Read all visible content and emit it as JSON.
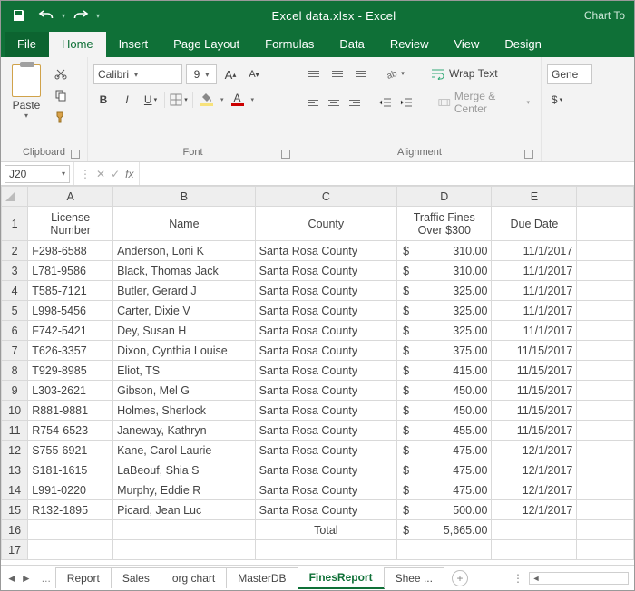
{
  "title": "Excel data.xlsx - Excel",
  "title_right": "Chart To",
  "tabs": {
    "file": "File",
    "home": "Home",
    "insert": "Insert",
    "pagelayout": "Page Layout",
    "formulas": "Formulas",
    "data": "Data",
    "review": "Review",
    "view": "View",
    "design": "Design"
  },
  "clipboard": {
    "paste": "Paste",
    "label": "Clipboard"
  },
  "font": {
    "name": "Calibri",
    "size": "9",
    "label": "Font"
  },
  "alignment": {
    "wrap": "Wrap Text",
    "merge": "Merge & Center",
    "label": "Alignment"
  },
  "number": {
    "format": "Gene"
  },
  "namebox": "J20",
  "fx": "",
  "columns": [
    "A",
    "B",
    "C",
    "D",
    "E"
  ],
  "headers": {
    "A": "License Number",
    "B": "Name",
    "C": "County",
    "D": "Traffic Fines Over $300",
    "E": "Due Date"
  },
  "rows": [
    {
      "n": "2",
      "A": "F298-6588",
      "B": "Anderson, Loni K",
      "C": "Santa Rosa County",
      "D": "310.00",
      "E": "11/1/2017"
    },
    {
      "n": "3",
      "A": "L781-9586",
      "B": "Black, Thomas Jack",
      "C": "Santa Rosa County",
      "D": "310.00",
      "E": "11/1/2017"
    },
    {
      "n": "4",
      "A": "T585-7121",
      "B": "Butler, Gerard J",
      "C": "Santa Rosa County",
      "D": "325.00",
      "E": "11/1/2017"
    },
    {
      "n": "5",
      "A": "L998-5456",
      "B": "Carter, Dixie V",
      "C": "Santa Rosa County",
      "D": "325.00",
      "E": "11/1/2017"
    },
    {
      "n": "6",
      "A": "F742-5421",
      "B": "Dey, Susan H",
      "C": "Santa Rosa County",
      "D": "325.00",
      "E": "11/1/2017"
    },
    {
      "n": "7",
      "A": "T626-3357",
      "B": "Dixon, Cynthia Louise",
      "C": "Santa Rosa County",
      "D": "375.00",
      "E": "11/15/2017"
    },
    {
      "n": "8",
      "A": "T929-8985",
      "B": "Eliot, TS",
      "C": "Santa Rosa County",
      "D": "415.00",
      "E": "11/15/2017"
    },
    {
      "n": "9",
      "A": "L303-2621",
      "B": "Gibson, Mel G",
      "C": "Santa Rosa County",
      "D": "450.00",
      "E": "11/15/2017"
    },
    {
      "n": "10",
      "A": "R881-9881",
      "B": "Holmes, Sherlock",
      "C": "Santa Rosa County",
      "D": "450.00",
      "E": "11/15/2017"
    },
    {
      "n": "11",
      "A": "R754-6523",
      "B": "Janeway, Kathryn",
      "C": "Santa Rosa County",
      "D": "455.00",
      "E": "11/15/2017"
    },
    {
      "n": "12",
      "A": "S755-6921",
      "B": "Kane, Carol Laurie",
      "C": "Santa Rosa County",
      "D": "475.00",
      "E": "12/1/2017"
    },
    {
      "n": "13",
      "A": "S181-1615",
      "B": "LaBeouf, Shia S",
      "C": "Santa Rosa County",
      "D": "475.00",
      "E": "12/1/2017"
    },
    {
      "n": "14",
      "A": "L991-0220",
      "B": "Murphy, Eddie R",
      "C": "Santa Rosa County",
      "D": "475.00",
      "E": "12/1/2017"
    },
    {
      "n": "15",
      "A": "R132-1895",
      "B": "Picard, Jean Luc",
      "C": "Santa Rosa County",
      "D": "500.00",
      "E": "12/1/2017"
    }
  ],
  "total": {
    "n": "16",
    "label": "Total",
    "value": "5,665.00"
  },
  "empty_row": "17",
  "currency": "$",
  "sheet_tabs": {
    "dots": "...",
    "report": "Report",
    "sales": "Sales",
    "orgchart": "org chart",
    "masterdb": "MasterDB",
    "fines": "FinesReport",
    "more": "Shee ..."
  }
}
